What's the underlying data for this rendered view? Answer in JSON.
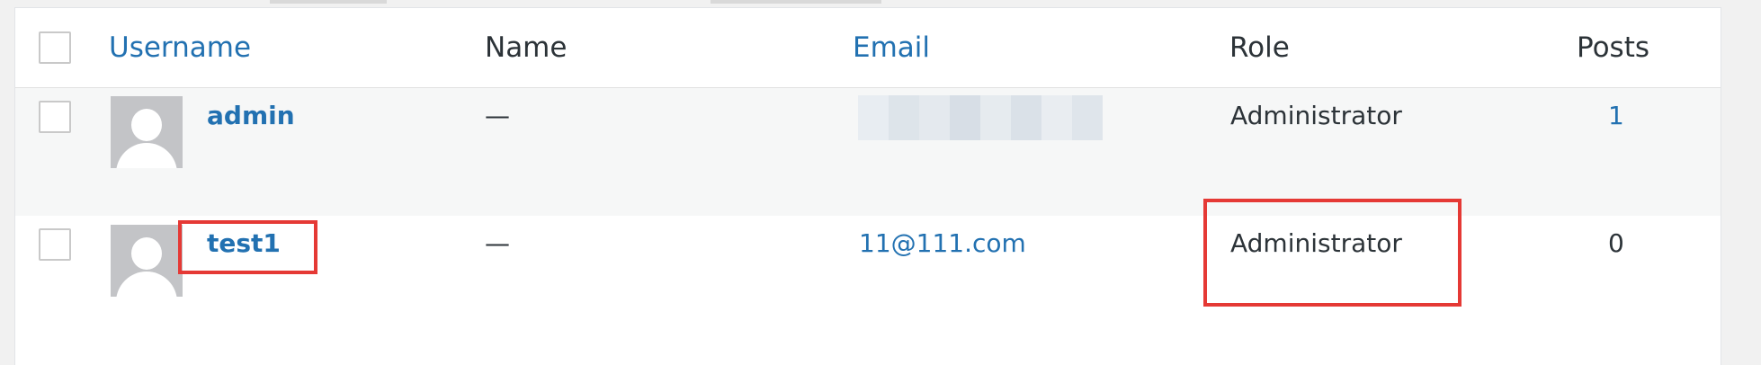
{
  "columns": {
    "username": "Username",
    "name": "Name",
    "email": "Email",
    "role": "Role",
    "posts": "Posts"
  },
  "users": [
    {
      "username": "admin",
      "name": "—",
      "email": "",
      "role": "Administrator",
      "posts": "1"
    },
    {
      "username": "test1",
      "name": "—",
      "email": "11@111.com",
      "role": "Administrator",
      "posts": "0"
    }
  ],
  "colors": {
    "link": "#2271b1",
    "text": "#2c3338",
    "highlight": "#e53935",
    "avatar_bg": "#c3c4c7",
    "alt_row": "#f6f7f7"
  },
  "icons": {
    "avatar": "default-user-avatar-icon",
    "checkbox": "checkbox"
  }
}
